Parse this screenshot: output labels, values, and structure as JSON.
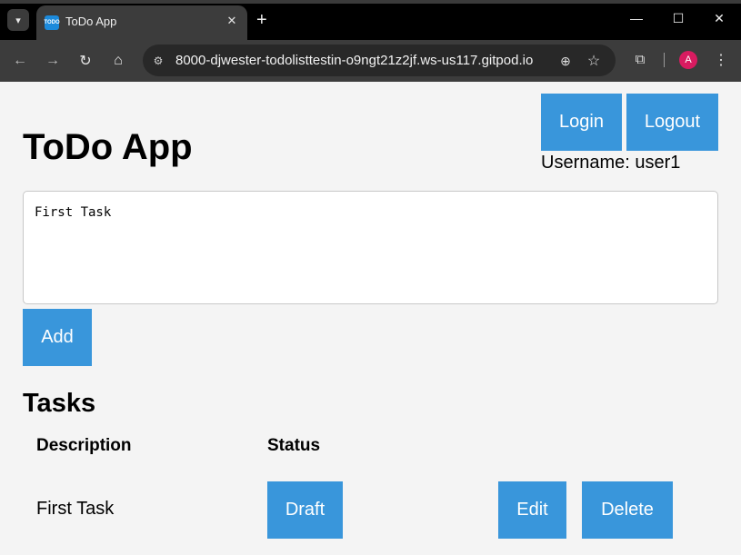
{
  "browser": {
    "tab": {
      "title": "ToDo App",
      "favicon_text": "TODO"
    },
    "address": {
      "url": "8000-djwester-todolisttestin-o9ngt21z2jf.ws-us117.gitpod.io"
    },
    "profile": {
      "initial": "A",
      "color": "#d81b60"
    }
  },
  "app": {
    "title": "ToDo App",
    "auth": {
      "login_label": "Login",
      "logout_label": "Logout",
      "username_text": "Username: user1"
    },
    "task_input": {
      "value": "First Task"
    },
    "add_label": "Add",
    "tasks": {
      "heading": "Tasks",
      "columns": [
        "Description",
        "Status"
      ],
      "rows": [
        {
          "description": "First Task",
          "status": "Draft",
          "edit_label": "Edit",
          "delete_label": "Delete"
        }
      ]
    }
  },
  "colors": {
    "accent": "#3996db",
    "page_bg": "#f4f4f4"
  }
}
